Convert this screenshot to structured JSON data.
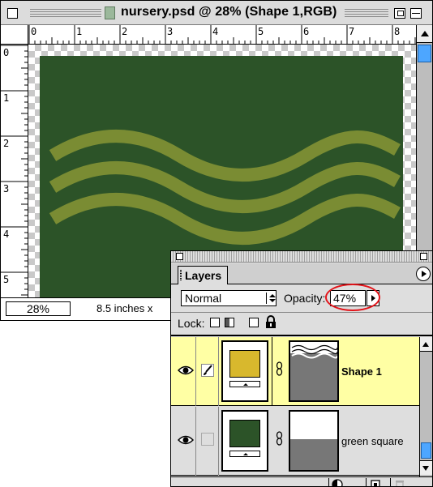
{
  "document": {
    "title": "nursery.psd @ 28% (Shape 1,RGB)",
    "zoom": "28%",
    "doc_size": "8.5 inches x",
    "ruler_h": [
      "0",
      "1",
      "2",
      "3",
      "4",
      "5",
      "6",
      "7",
      "8"
    ],
    "ruler_v": [
      "0",
      "1",
      "2",
      "3",
      "4",
      "5"
    ],
    "canvas_fill_color": "#2c5328",
    "wave_color": "#7a8c33"
  },
  "layers_panel": {
    "tab_label": "Layers",
    "blend_mode": "Normal",
    "opacity_label": "Opacity:",
    "opacity_value": "47%",
    "lock_label": "Lock:",
    "layers": [
      {
        "name": "Shape 1",
        "visible": true,
        "selected": true,
        "swatch_color": "#d8b82d"
      },
      {
        "name": "green square",
        "visible": true,
        "selected": false,
        "swatch_color": "#2c5328"
      }
    ],
    "annotation_color": "#e3141a"
  }
}
